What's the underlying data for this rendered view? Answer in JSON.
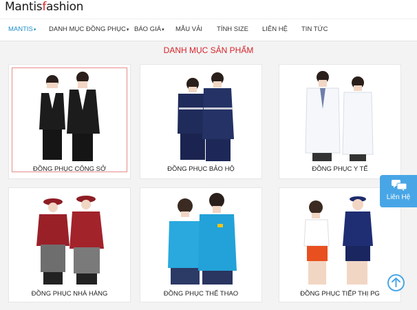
{
  "logo": {
    "part1": "Mantis",
    "part2": "f",
    "part3": "ashion"
  },
  "nav": [
    {
      "label": "MANTIS",
      "caret": true
    },
    {
      "label": "DANH MỤC ĐỒNG PHỤC",
      "caret": true
    },
    {
      "label": "BÁO GIÁ",
      "caret": true
    },
    {
      "label": "MẪU VẢI",
      "caret": false
    },
    {
      "label": "TÍNH SIZE",
      "caret": false
    },
    {
      "label": "LIÊN HỆ",
      "caret": false
    },
    {
      "label": "TIN TỨC",
      "caret": false
    }
  ],
  "section_title": "DANH MỤC SẢN PHẨM",
  "products": [
    {
      "label": "ĐỒNG PHỤC CÔNG SỞ"
    },
    {
      "label": "ĐỒNG PHỤC BẢO HỘ"
    },
    {
      "label": "ĐỒNG PHỤC Y TẾ"
    },
    {
      "label": "ĐỒNG PHỤC NHÀ HÀNG"
    },
    {
      "label": "ĐỒNG PHỤC THỂ THAO"
    },
    {
      "label": "ĐỒNG PHỤC TIẾP THỊ PG"
    }
  ],
  "contact": {
    "label": "Liên Hệ",
    "icon": "chat-bubbles-icon"
  },
  "scroll_top": {
    "icon": "arrow-up-icon"
  },
  "colors": {
    "accent_red": "#d6232a",
    "accent_blue": "#1d8fc8",
    "contact_bg": "#49a6e6"
  }
}
